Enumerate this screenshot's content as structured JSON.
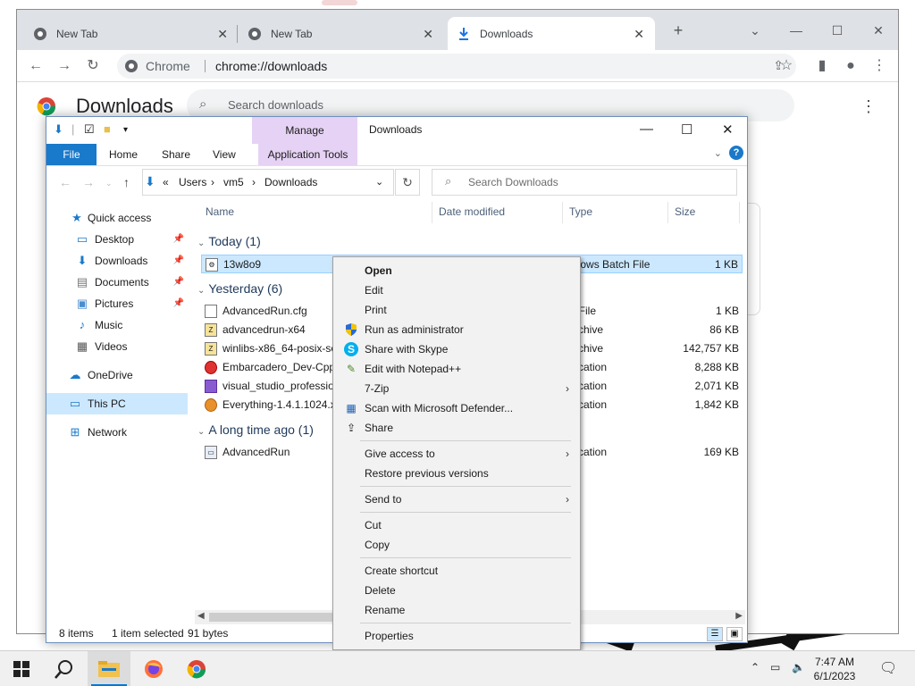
{
  "chrome": {
    "tabs": [
      {
        "label": "New Tab",
        "icon": "chrome-favicon-icon"
      },
      {
        "label": "New Tab",
        "icon": "chrome-favicon-icon"
      },
      {
        "label": "Downloads",
        "icon": "download-icon"
      }
    ],
    "omnibox": {
      "site": "Chrome",
      "url": "chrome://downloads"
    },
    "page": {
      "title": "Downloads",
      "search_placeholder": "Search downloads"
    }
  },
  "explorer": {
    "title": "Downloads",
    "manage_label": "Manage",
    "ribbon_tabs": [
      "File",
      "Home",
      "Share",
      "View",
      "Application Tools"
    ],
    "breadcrumb": [
      "«",
      "Users",
      "vm5",
      "Downloads"
    ],
    "search_placeholder": "Search Downloads",
    "nav": [
      {
        "label": "Quick access",
        "icon": "star-icon"
      },
      {
        "label": "Desktop",
        "icon": "desktop-icon",
        "pinned": true
      },
      {
        "label": "Downloads",
        "icon": "download-icon",
        "pinned": true
      },
      {
        "label": "Documents",
        "icon": "document-icon",
        "pinned": true
      },
      {
        "label": "Pictures",
        "icon": "picture-icon",
        "pinned": true
      },
      {
        "label": "Music",
        "icon": "music-icon"
      },
      {
        "label": "Videos",
        "icon": "video-icon"
      },
      {
        "label": "OneDrive",
        "icon": "cloud-icon"
      },
      {
        "label": "This PC",
        "icon": "computer-icon"
      },
      {
        "label": "Network",
        "icon": "network-icon"
      }
    ],
    "columns": [
      "Name",
      "Date modified",
      "Type",
      "Size"
    ],
    "groups": [
      {
        "label": "Today (1)",
        "rows": [
          {
            "name": "13w8o9",
            "type": "ndows Batch File",
            "size": "1 KB",
            "selected": true
          }
        ]
      },
      {
        "label": "Yesterday (6)",
        "rows": [
          {
            "name": "AdvancedRun.cfg",
            "type": "G File",
            "size": "1 KB"
          },
          {
            "name": "advancedrun-x64",
            "type": "Archive",
            "size": "86 KB"
          },
          {
            "name": "winlibs-x86_64-posix-se",
            "type": "Archive",
            "size": "142,757 KB"
          },
          {
            "name": "Embarcadero_Dev-Cpp",
            "type": "plication",
            "size": "8,288 KB"
          },
          {
            "name": "visual_studio_professio",
            "type": "plication",
            "size": "2,071 KB"
          },
          {
            "name": "Everything-1.4.1.1024.x",
            "type": "plication",
            "size": "1,842 KB"
          }
        ]
      },
      {
        "label": "A long time ago (1)",
        "rows": [
          {
            "name": "AdvancedRun",
            "type": "plication",
            "size": "169 KB"
          }
        ]
      }
    ],
    "status": {
      "items": "8 items",
      "selected": "1 item selected",
      "bytes": "91 bytes"
    }
  },
  "context_menu": {
    "items": [
      {
        "label": "Open",
        "bold": true
      },
      {
        "label": "Edit"
      },
      {
        "label": "Print"
      },
      {
        "label": "Run as administrator",
        "icon": "shield-icon"
      },
      {
        "label": "Share with Skype",
        "icon": "skype-icon"
      },
      {
        "label": "Edit with Notepad++",
        "icon": "notepad-plus-plus-icon"
      },
      {
        "label": "7-Zip",
        "submenu": true
      },
      {
        "label": "Scan with Microsoft Defender...",
        "icon": "defender-icon"
      },
      {
        "label": "Share",
        "icon": "share-icon"
      },
      {
        "label": "Give access to",
        "submenu": true
      },
      {
        "label": "Restore previous versions"
      },
      {
        "label": "Send to",
        "submenu": true
      },
      {
        "label": "Cut"
      },
      {
        "label": "Copy"
      },
      {
        "label": "Create shortcut"
      },
      {
        "label": "Delete"
      },
      {
        "label": "Rename"
      },
      {
        "label": "Properties"
      }
    ]
  },
  "taskbar": {
    "time": "7:47 AM",
    "date": "6/1/2023",
    "apps": [
      "windows-start-icon",
      "search-icon",
      "file-explorer-icon",
      "firefox-icon",
      "chrome-icon"
    ]
  },
  "colors": {
    "accent": "#1979ca",
    "selection": "#cce8ff",
    "manage_tab": "#e6d2f4",
    "taskbar_accent": "#0078d7"
  }
}
